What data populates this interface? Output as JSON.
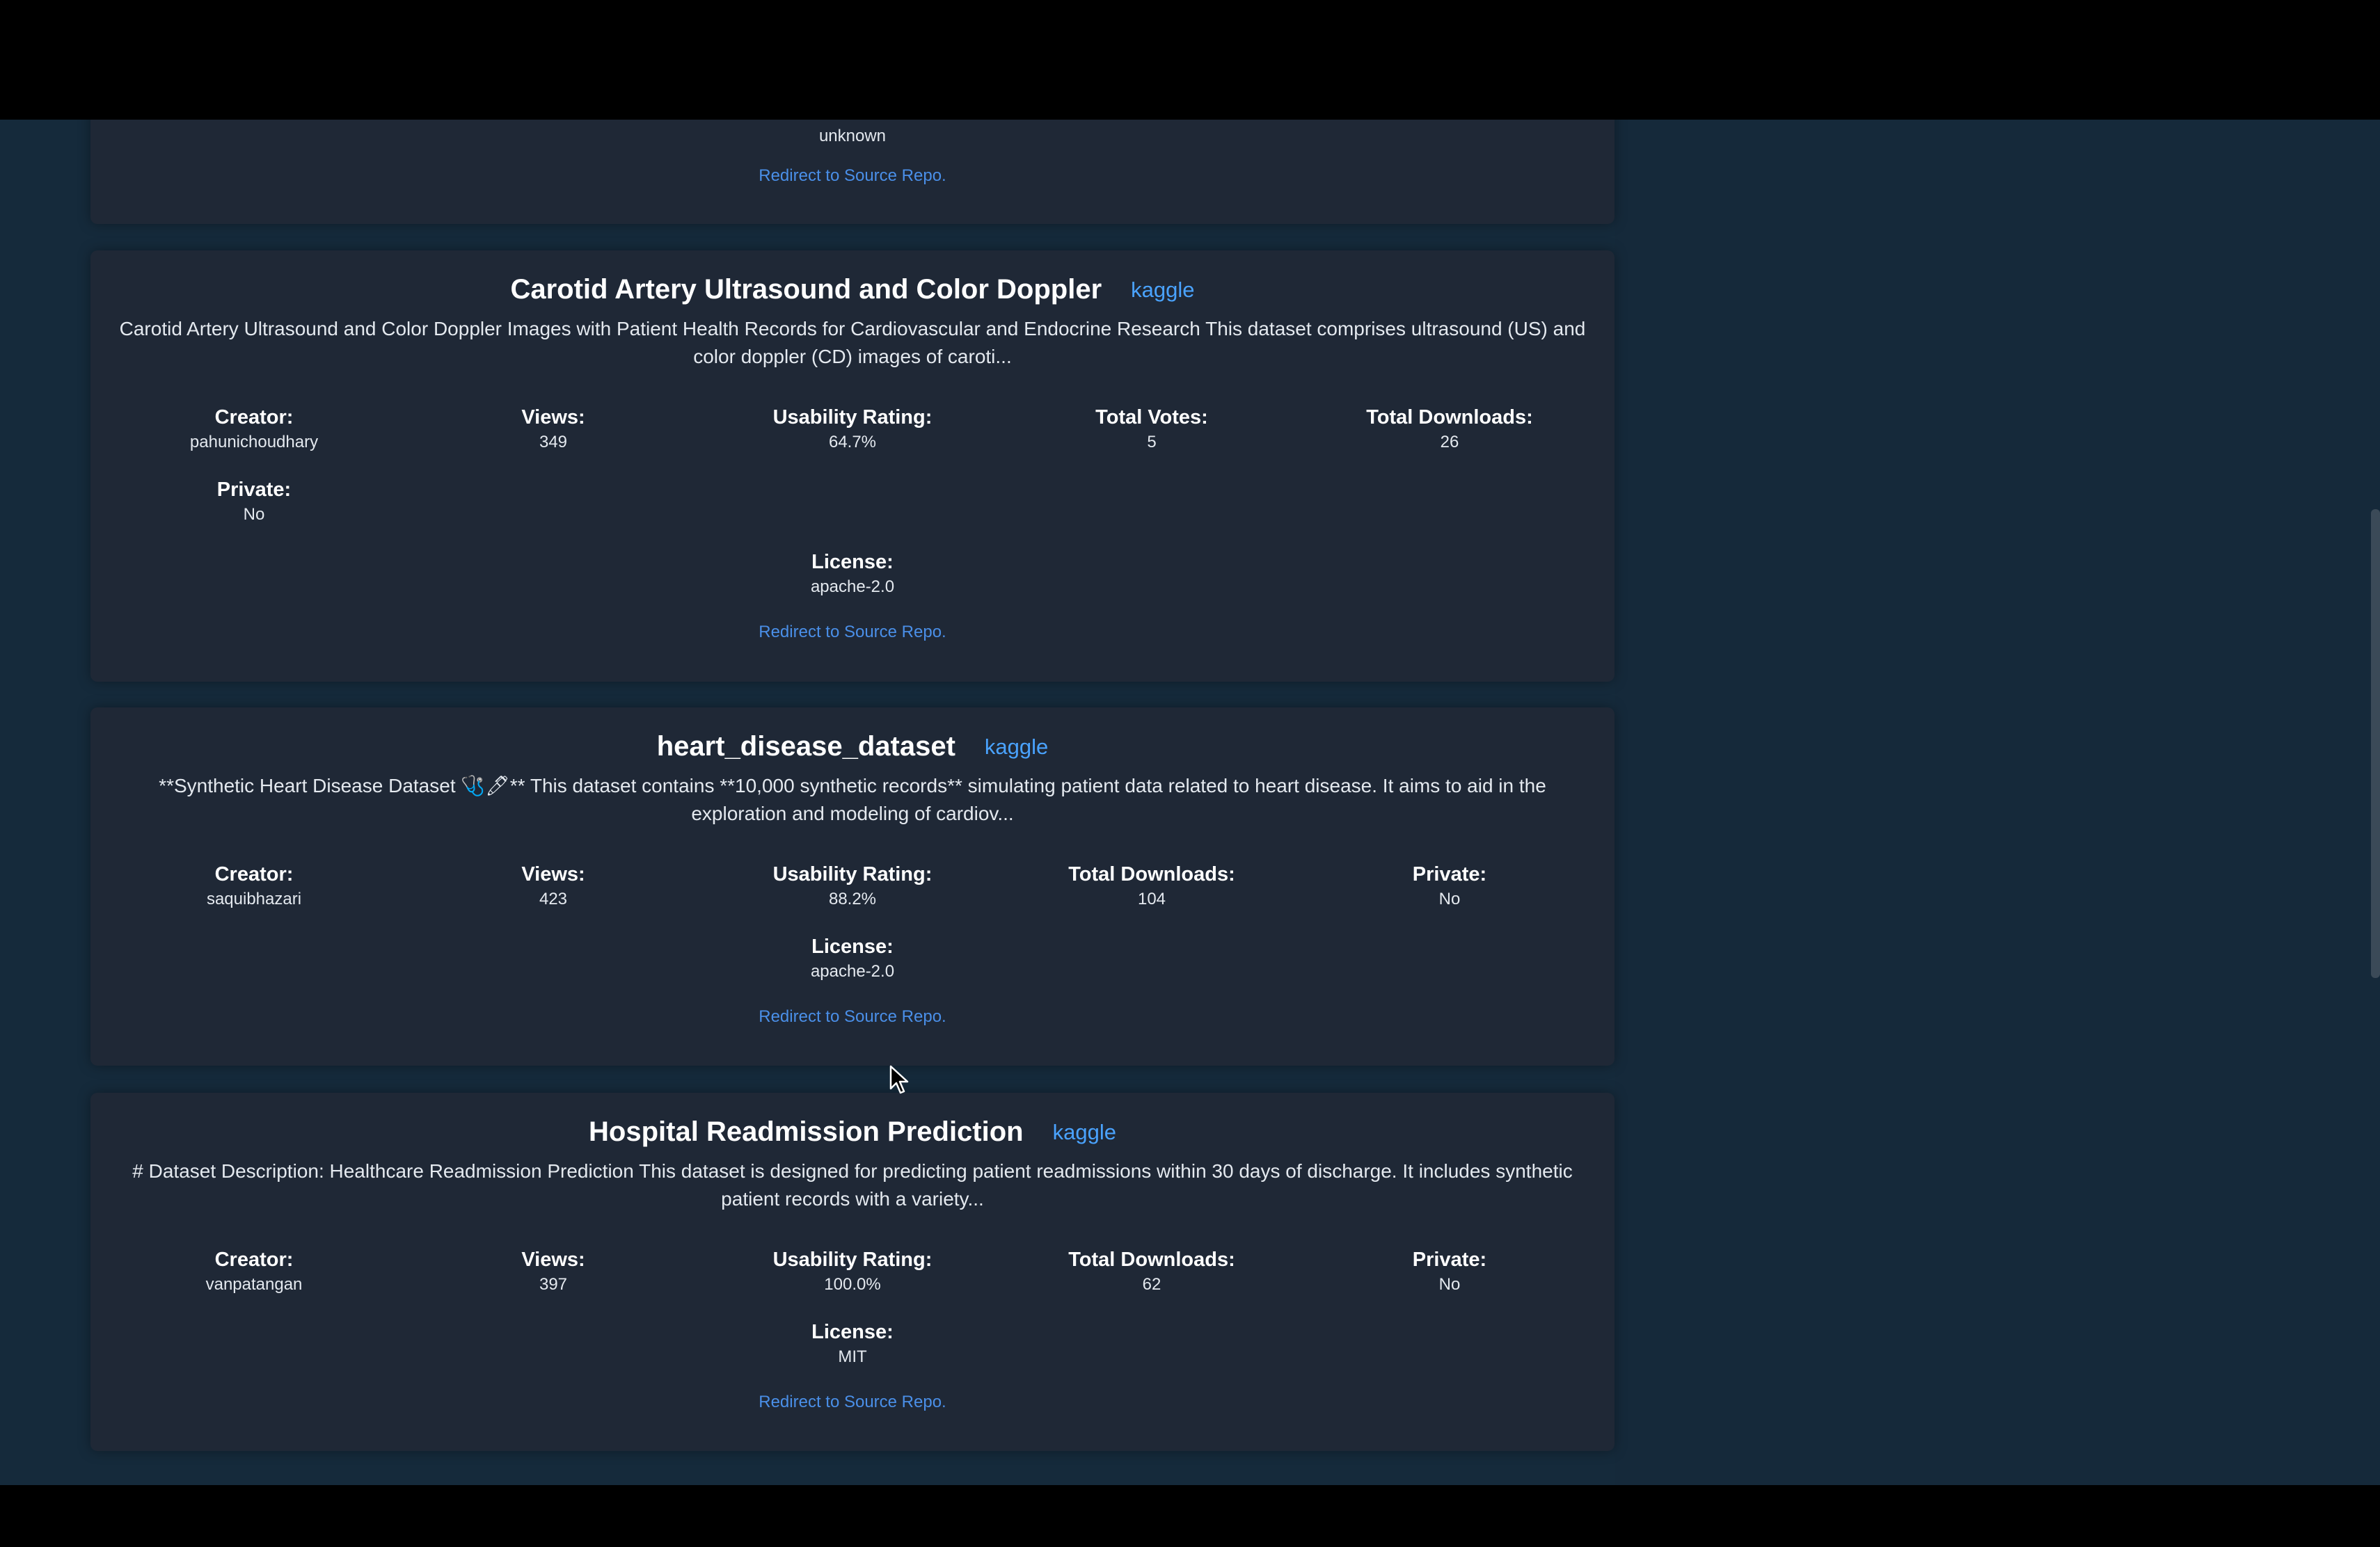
{
  "partial_card": {
    "license_value": "unknown",
    "repo_link": "Redirect to Source Repo."
  },
  "cards": [
    {
      "title": "Carotid Artery Ultrasound and Color Doppler",
      "source": "kaggle",
      "description": "Carotid Artery Ultrasound and Color Doppler Images with Patient Health Records for Cardiovascular and Endocrine Research This dataset comprises ultrasound (US) and color doppler (CD) images of caroti...",
      "stats": [
        {
          "label": "Creator:",
          "value": "pahunichoudhary"
        },
        {
          "label": "Views:",
          "value": "349"
        },
        {
          "label": "Usability Rating:",
          "value": "64.7%"
        },
        {
          "label": "Total Votes:",
          "value": "5"
        },
        {
          "label": "Total Downloads:",
          "value": "26"
        },
        {
          "label": "Private:",
          "value": "No"
        },
        {
          "label": "License:",
          "value": "apache-2.0"
        }
      ],
      "repo_link": "Redirect to Source Repo."
    },
    {
      "title": "heart_disease_dataset",
      "source": "kaggle",
      "description": "**Synthetic Heart Disease Dataset 🩺🖊** This dataset contains **10,000 synthetic records** simulating patient data related to heart disease. It aims to aid in the exploration and modeling of cardiov...",
      "stats": [
        {
          "label": "Creator:",
          "value": "saquibhazari"
        },
        {
          "label": "Views:",
          "value": "423"
        },
        {
          "label": "Usability Rating:",
          "value": "88.2%"
        },
        {
          "label": "Total Downloads:",
          "value": "104"
        },
        {
          "label": "Private:",
          "value": "No"
        },
        {
          "label": "License:",
          "value": "apache-2.0"
        }
      ],
      "repo_link": "Redirect to Source Repo."
    },
    {
      "title": "Hospital Readmission Prediction",
      "source": "kaggle",
      "description": "# Dataset Description: Healthcare Readmission Prediction This dataset is designed for predicting patient readmissions within 30 days of discharge. It includes synthetic patient records with a variety...",
      "stats": [
        {
          "label": "Creator:",
          "value": "vanpatangan"
        },
        {
          "label": "Views:",
          "value": "397"
        },
        {
          "label": "Usability Rating:",
          "value": "100.0%"
        },
        {
          "label": "Total Downloads:",
          "value": "62"
        },
        {
          "label": "Private:",
          "value": "No"
        },
        {
          "label": "License:",
          "value": "MIT"
        }
      ],
      "repo_link": "Redirect to Source Repo."
    }
  ]
}
